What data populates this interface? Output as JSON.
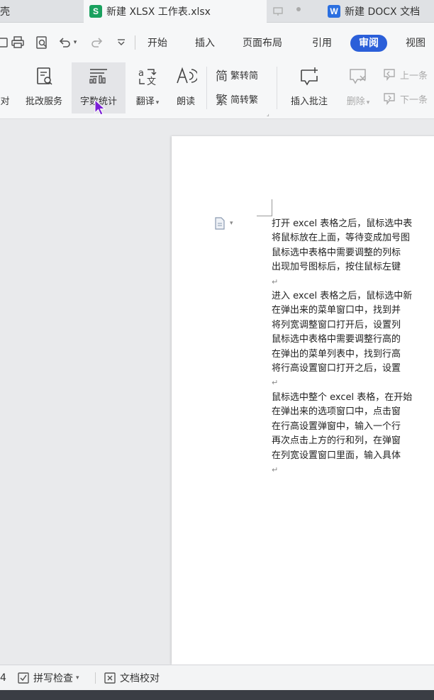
{
  "tabs": [
    {
      "label": "壳",
      "badge": ""
    },
    {
      "label": "新建 XLSX 工作表.xlsx",
      "badge": "S"
    },
    {
      "label": "新建 DOCX 文档",
      "badge": "W"
    }
  ],
  "menu": {
    "items": [
      "开始",
      "插入",
      "页面布局",
      "引用",
      "审阅",
      "视图"
    ],
    "active": "审阅"
  },
  "ribbon": {
    "proofread_partial": "对",
    "revise_service": "批改服务",
    "word_count": "字数统计",
    "translate": "翻译",
    "read_aloud": "朗读",
    "trad_to_simp": "繁转简",
    "simp_to_trad": "简转繁",
    "insert_comment": "插入批注",
    "delete": "删除",
    "prev_partial": "上一条",
    "next_partial": "下一条"
  },
  "document": {
    "lines": [
      "打开 excel 表格之后，鼠标选中表",
      "将鼠标放在上面，等待变成加号图",
      "鼠标选中表格中需要调整的列标",
      "出现加号图标后，按住鼠标左键",
      "进入 excel 表格之后，鼠标选中新",
      "在弹出来的菜单窗口中，找到并",
      "将列宽调整窗口打开后，设置列",
      "鼠标选中表格中需要调整行高的",
      "在弹出的菜单列表中，找到行高",
      "将行高设置窗口打开之后，设置",
      "鼠标选中整个 excel 表格，在开始",
      "在弹出来的选项窗口中，点击窗",
      "在行高设置弹窗中，输入一个行",
      "再次点击上方的行和列，在弹窗",
      "在列宽设置窗口里面，输入具体"
    ],
    "para_mark": "↵"
  },
  "status": {
    "page_partial": "4",
    "spell_check": "拼写检查",
    "doc_proof": "文档校对"
  }
}
